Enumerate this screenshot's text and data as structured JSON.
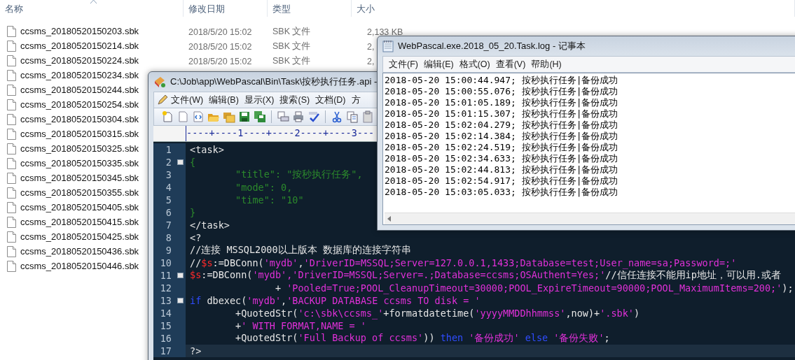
{
  "explorer": {
    "columns": [
      "名称",
      "修改日期",
      "类型",
      "大小"
    ],
    "files": [
      {
        "name": "ccsms_20180520150203.sbk",
        "date": "2018/5/20 15:02",
        "type": "SBK 文件",
        "size": "2,133 KB"
      },
      {
        "name": "ccsms_20180520150214.sbk",
        "date": "2018/5/20 15:02",
        "type": "SBK 文件",
        "size": "2,"
      },
      {
        "name": "ccsms_20180520150224.sbk",
        "date": "2018/5/20 15:02",
        "type": "SBK 文件",
        "size": "2,"
      },
      {
        "name": "ccsms_20180520150234.sbk"
      },
      {
        "name": "ccsms_20180520150244.sbk"
      },
      {
        "name": "ccsms_20180520150254.sbk"
      },
      {
        "name": "ccsms_20180520150304.sbk"
      },
      {
        "name": "ccsms_20180520150315.sbk"
      },
      {
        "name": "ccsms_20180520150325.sbk"
      },
      {
        "name": "ccsms_20180520150335.sbk"
      },
      {
        "name": "ccsms_20180520150345.sbk"
      },
      {
        "name": "ccsms_20180520150355.sbk"
      },
      {
        "name": "ccsms_20180520150405.sbk"
      },
      {
        "name": "ccsms_20180520150415.sbk"
      },
      {
        "name": "ccsms_20180520150425.sbk"
      },
      {
        "name": "ccsms_20180520150436.sbk"
      },
      {
        "name": "ccsms_20180520150446.sbk"
      }
    ]
  },
  "editor": {
    "title": "C:\\Job\\app\\WebPascal\\Bin\\Task\\按秒执行任务.api -",
    "menu": [
      "文件(W)",
      "编辑(B)",
      "显示(X)",
      "搜索(S)",
      "文档(D)",
      "方"
    ],
    "ruler": "----+----1----+----2----+----3---",
    "lines": [
      {
        "number": "1",
        "foldable": false,
        "current": false,
        "tokens": [
          {
            "kind": "plain",
            "text": "<task>"
          }
        ]
      },
      {
        "number": "2",
        "foldable": true,
        "current": false,
        "tokens": [
          {
            "kind": "json",
            "text": "{"
          }
        ]
      },
      {
        "number": "3",
        "foldable": false,
        "current": false,
        "tokens": [
          {
            "kind": "json",
            "text": "        \"title\": \"按秒执行任务\","
          }
        ]
      },
      {
        "number": "4",
        "foldable": false,
        "current": false,
        "tokens": [
          {
            "kind": "json",
            "text": "        \"mode\": 0,"
          }
        ]
      },
      {
        "number": "5",
        "foldable": false,
        "current": false,
        "tokens": [
          {
            "kind": "json",
            "text": "        \"time\": \"10\""
          }
        ]
      },
      {
        "number": "6",
        "foldable": false,
        "current": false,
        "tokens": [
          {
            "kind": "json",
            "text": "}"
          }
        ]
      },
      {
        "number": "7",
        "foldable": false,
        "current": false,
        "tokens": [
          {
            "kind": "plain",
            "text": "</task>"
          }
        ]
      },
      {
        "number": "8",
        "foldable": false,
        "current": false,
        "tokens": [
          {
            "kind": "plain",
            "text": "<?"
          }
        ]
      },
      {
        "number": "9",
        "foldable": false,
        "current": false,
        "tokens": [
          {
            "kind": "plain",
            "text": "//连接 MSSQL2000以上版本 数据库的连接字符串"
          }
        ]
      },
      {
        "number": "10",
        "foldable": false,
        "current": false,
        "tokens": [
          {
            "kind": "plain",
            "text": "//"
          },
          {
            "kind": "variable",
            "text": "$s"
          },
          {
            "kind": "plain",
            "text": ":=DBConn("
          },
          {
            "kind": "string",
            "text": "'mydb'"
          },
          {
            "kind": "plain",
            "text": ","
          },
          {
            "kind": "string",
            "text": "'DriverID=MSSQL;Server=127.0.0.1,1433;Database=test;User_name=sa;Password=;'"
          }
        ]
      },
      {
        "number": "11",
        "foldable": true,
        "current": false,
        "tokens": [
          {
            "kind": "variable",
            "text": "$s"
          },
          {
            "kind": "plain",
            "text": ":=DBConn("
          },
          {
            "kind": "string",
            "text": "'mydb',"
          },
          {
            "kind": "string",
            "text": "'DriverID=MSSQL;Server=.;Database=ccsms;OSAuthent=Yes;'"
          },
          {
            "kind": "plain",
            "text": "//信任连接不能用ip地址，可以用.或者"
          }
        ]
      },
      {
        "number": "12",
        "foldable": false,
        "current": false,
        "tokens": [
          {
            "kind": "plain",
            "text": "               + "
          },
          {
            "kind": "string",
            "text": "'Pooled=True;POOL_CleanupTimeout=30000;POOL_ExpireTimeout=90000;POOL_MaximumItems=200;'"
          },
          {
            "kind": "plain",
            "text": ");"
          }
        ]
      },
      {
        "number": "13",
        "foldable": true,
        "current": false,
        "tokens": [
          {
            "kind": "keyword",
            "text": "if"
          },
          {
            "kind": "plain",
            "text": " dbexec("
          },
          {
            "kind": "string",
            "text": "'mydb'"
          },
          {
            "kind": "plain",
            "text": ","
          },
          {
            "kind": "string",
            "text": "'BACKUP DATABASE ccsms TO disk = '"
          }
        ]
      },
      {
        "number": "14",
        "foldable": false,
        "current": false,
        "tokens": [
          {
            "kind": "plain",
            "text": "        +QuotedStr("
          },
          {
            "kind": "string",
            "text": "'c:\\sbk\\ccsms_'"
          },
          {
            "kind": "plain",
            "text": "+formatdatetime("
          },
          {
            "kind": "string",
            "text": "'yyyyMMDDhhmmss'"
          },
          {
            "kind": "plain",
            "text": ",now)+"
          },
          {
            "kind": "string",
            "text": "'.sbk'"
          },
          {
            "kind": "plain",
            "text": ")"
          }
        ]
      },
      {
        "number": "15",
        "foldable": false,
        "current": false,
        "tokens": [
          {
            "kind": "plain",
            "text": "        +"
          },
          {
            "kind": "string",
            "text": "' WITH FORMAT,NAME = '"
          }
        ]
      },
      {
        "number": "16",
        "foldable": false,
        "current": false,
        "tokens": [
          {
            "kind": "plain",
            "text": "        +QuotedStr("
          },
          {
            "kind": "string",
            "text": "'Full Backup of ccsms'"
          },
          {
            "kind": "plain",
            "text": ")) "
          },
          {
            "kind": "keyword",
            "text": "then"
          },
          {
            "kind": "string",
            "text": " '备份成功'"
          },
          {
            "kind": "keyword",
            "text": " else"
          },
          {
            "kind": "string",
            "text": " '备份失败'"
          },
          {
            "kind": "plain",
            "text": ";"
          }
        ]
      },
      {
        "number": "17",
        "foldable": false,
        "current": true,
        "tokens": [
          {
            "kind": "plain",
            "text": "?>"
          }
        ]
      }
    ]
  },
  "notepad": {
    "title": "WebPascal.exe.2018_05_20.Task.log - 记事本",
    "menu": [
      "文件(F)",
      "编辑(E)",
      "格式(O)",
      "查看(V)",
      "帮助(H)"
    ],
    "lines": [
      "2018-05-20 15:00:44.947; 按秒执行任务|备份成功",
      "2018-05-20 15:00:55.076; 按秒执行任务|备份成功",
      "2018-05-20 15:01:05.189; 按秒执行任务|备份成功",
      "2018-05-20 15:01:15.307; 按秒执行任务|备份成功",
      "2018-05-20 15:02:04.279; 按秒执行任务|备份成功",
      "2018-05-20 15:02:14.384; 按秒执行任务|备份成功",
      "2018-05-20 15:02:24.519; 按秒执行任务|备份成功",
      "2018-05-20 15:02:34.633; 按秒执行任务|备份成功",
      "2018-05-20 15:02:44.813; 按秒执行任务|备份成功",
      "2018-05-20 15:02:54.917; 按秒执行任务|备份成功",
      "2018-05-20 15:03:05.033; 按秒执行任务|备份成功"
    ]
  }
}
